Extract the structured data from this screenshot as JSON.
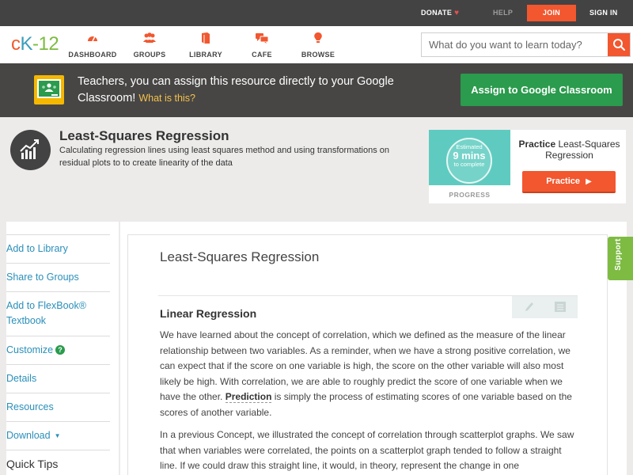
{
  "topbar": {
    "donate": "DONATE",
    "help": "HELP",
    "join": "JOIN",
    "sign_in": "SIGN IN"
  },
  "brand": {
    "logo_c": "c",
    "logo_k": "K",
    "logo_num": "-12",
    "accent": "#f2572f",
    "blue": "#3a9ebd",
    "green": "#7dbb42"
  },
  "nav": {
    "items": [
      {
        "label": "DASHBOARD",
        "icon": "dashboard-icon"
      },
      {
        "label": "GROUPS",
        "icon": "groups-icon"
      },
      {
        "label": "LIBRARY",
        "icon": "library-icon"
      },
      {
        "label": "CAFE",
        "icon": "cafe-icon"
      },
      {
        "label": "BROWSE",
        "icon": "browse-icon"
      }
    ],
    "search_placeholder": "What do you want to learn today?"
  },
  "banner": {
    "text": "Teachers, you can assign this resource directly to your Google Classroom!",
    "link": "What is this?",
    "assign_button": "Assign to Google Classroom"
  },
  "concept": {
    "title": "Least-Squares Regression",
    "description": "Calculating regression lines using least squares method and using transformations on residual plots to to create linearity of the data"
  },
  "practice": {
    "estimated": "Estimated",
    "minutes": "9 mins",
    "to_complete": "to complete",
    "progress_label": "PROGRESS",
    "title_bold": "Practice",
    "title_rest": "Least-Squares Regression",
    "button": "Practice"
  },
  "sidebar": {
    "items": [
      {
        "label": "Add to Library"
      },
      {
        "label": "Share to Groups"
      },
      {
        "label": "Add to FlexBook® Textbook"
      },
      {
        "label": "Customize"
      },
      {
        "label": "Details"
      },
      {
        "label": "Resources"
      },
      {
        "label": "Download"
      }
    ],
    "quick_tips": "Quick Tips"
  },
  "article": {
    "title": "Least-Squares Regression",
    "section_title": "Linear Regression",
    "para1_before": "We have learned about the concept of correlation, which we defined as the measure of the linear relationship between two variables. As a reminder, when we have a strong positive correlation, we can expect that if the score on one variable is high, the score on the other variable will also most likely be high. With correlation, we are able to roughly predict the score of one variable when we have the other. ",
    "para1_keyword": "Prediction",
    "para1_after": " is simply the process of estimating scores of one variable based on the scores of another variable.",
    "para2": "In a previous Concept, we illustrated the concept of correlation through scatterplot graphs. We saw that when variables were correlated, the points on a scatterplot graph tended to follow a straight line. If we could draw this straight line, it would, in theory, represent the change in one"
  },
  "support_tab": "Support"
}
